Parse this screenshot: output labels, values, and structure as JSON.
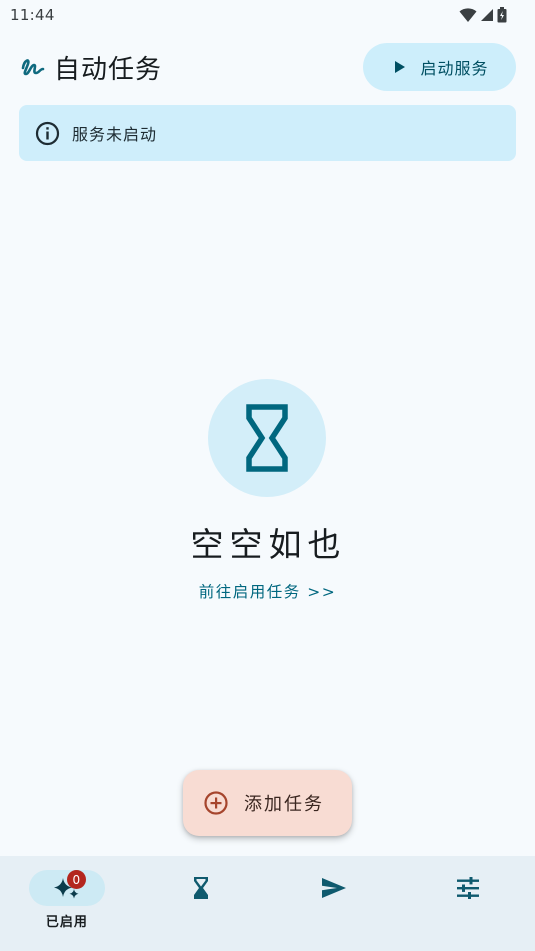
{
  "status_bar": {
    "time": "11:44"
  },
  "header": {
    "title": "自动任务",
    "start_button_label": "启动服务"
  },
  "banner": {
    "text": "服务未启动"
  },
  "empty_state": {
    "title": "空空如也",
    "link": "前往启用任务 >>"
  },
  "fab": {
    "label": "添加任务"
  },
  "bottom_nav": {
    "items": [
      {
        "label": "已启用",
        "icon": "sparkles-icon",
        "badge": "0",
        "active": true
      },
      {
        "label": "",
        "icon": "hourglass-icon"
      },
      {
        "label": "",
        "icon": "send-icon"
      },
      {
        "label": "",
        "icon": "tune-icon"
      }
    ]
  },
  "colors": {
    "accent": "#00677f",
    "background": "#f6fafd",
    "banner": "#cfeefb",
    "fab": "#f8dcd3",
    "fab_icon": "#a6452d",
    "badge": "#b3261e"
  }
}
